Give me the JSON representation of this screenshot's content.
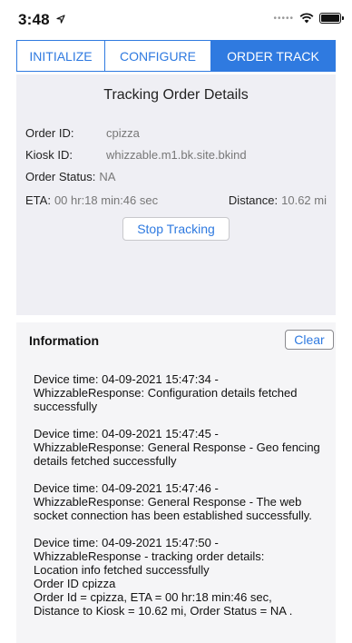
{
  "status_bar": {
    "time": "3:48",
    "location_icon": "location-arrow-icon",
    "signal_icon": "signal-dots-icon",
    "wifi_icon": "wifi-icon",
    "battery_icon": "battery-icon"
  },
  "tabs": [
    {
      "label": "INITIALIZE",
      "active": false
    },
    {
      "label": "CONFIGURE",
      "active": false
    },
    {
      "label": "ORDER TRACK",
      "active": true
    }
  ],
  "tracking": {
    "title": "Tracking Order Details",
    "order_id_label": "Order ID:",
    "order_id_value": "cpizza",
    "kiosk_id_label": "Kiosk ID:",
    "kiosk_id_value": "whizzable.m1.bk.site.bkind",
    "order_status_label": "Order Status:",
    "order_status_value": "NA",
    "eta_label": "ETA:",
    "eta_value": "00 hr:18 min:46 sec",
    "distance_label": "Distance:",
    "distance_value": "10.62 mi",
    "stop_button": "Stop Tracking"
  },
  "information": {
    "title": "Information",
    "clear_button": "Clear",
    "log": [
      "Device time: 04-09-2021 15:47:34 -\nWhizzableResponse: Configuration details fetched successfully",
      "Device time: 04-09-2021 15:47:45 -\nWhizzableResponse: General Response - Geo fencing details fetched successfully",
      "Device time: 04-09-2021 15:47:46 -\nWhizzableResponse: General Response - The web socket connection has been established successfully.",
      "Device time: 04-09-2021 15:47:50 -\nWhizzableResponse - tracking order details:\nLocation info fetched successfully\n Order ID cpizza\nOrder Id = cpizza, ETA = 00 hr:18 min:46 sec,\nDistance to Kiosk = 10.62 mi, Order Status = NA ."
    ]
  },
  "colors": {
    "accent": "#2f7ae0",
    "panel_bg": "#efeff4",
    "info_bg": "#f5f5f7"
  }
}
